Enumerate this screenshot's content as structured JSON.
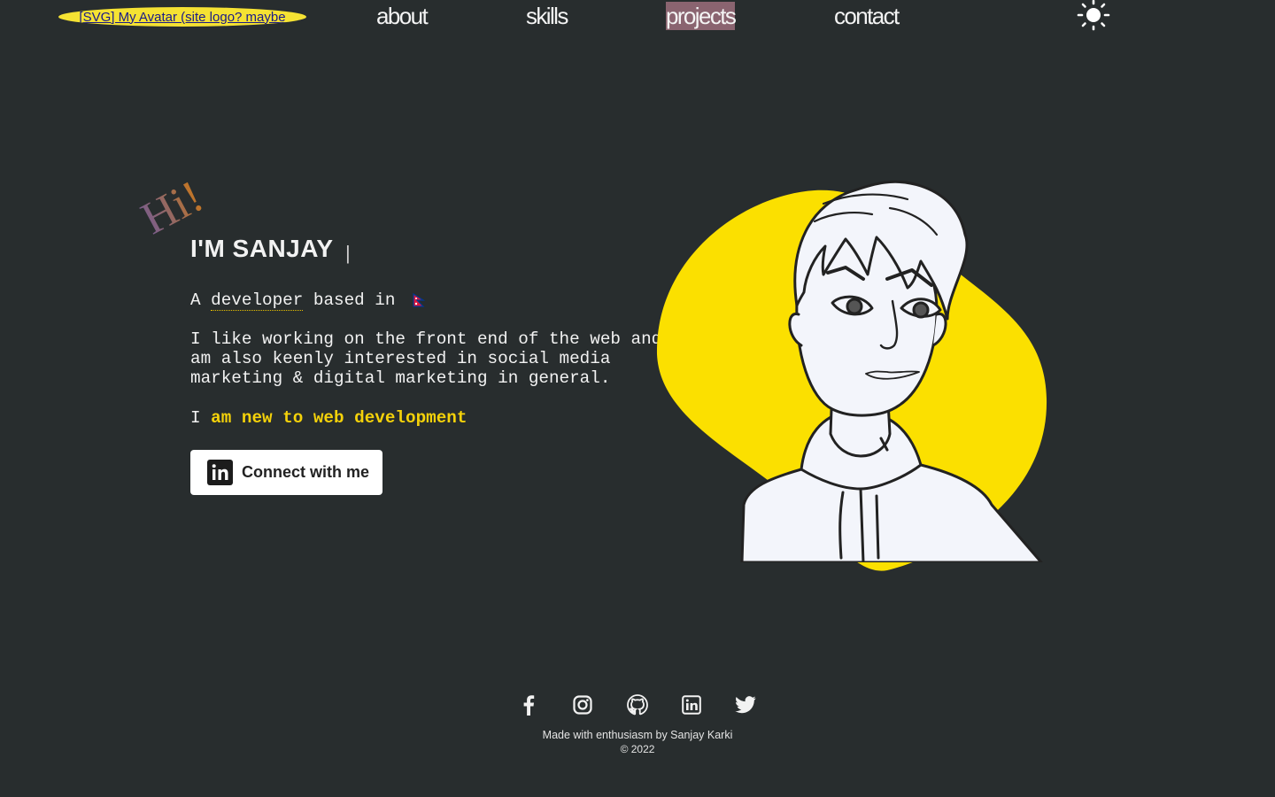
{
  "header": {
    "logo_alt": "[SVG] My Avatar (site logo? maybe",
    "nav": [
      {
        "label": "about"
      },
      {
        "label": "skills"
      },
      {
        "label": "projects",
        "active": true
      },
      {
        "label": "contact"
      }
    ],
    "theme_toggle_icon": "sun-icon"
  },
  "hero": {
    "greeting": "Hi!",
    "headline": "I'M SANJAY",
    "cursor": "|",
    "line1_prefix": "A",
    "line1_role": "developer",
    "line1_suffix": "based in",
    "flag_icon": "nepal-flag-icon",
    "bio": "I like working on the front end of the web and am also keenly interested in social media marketing & digital marketing in general.",
    "line3_prefix": "I",
    "line3_highlight": "am new to web development",
    "cta_label": "Connect with me",
    "cta_icon": "linkedin-icon",
    "avatar": "avatar-illustration"
  },
  "footer": {
    "social": [
      {
        "icon": "facebook-icon"
      },
      {
        "icon": "instagram-icon"
      },
      {
        "icon": "github-icon"
      },
      {
        "icon": "linkedin-icon"
      },
      {
        "icon": "twitter-icon"
      }
    ],
    "credit": "Made with enthusiasm by Sanjay Karki",
    "copyright": "© 2022"
  },
  "colors": {
    "background": "#282d2e",
    "accent": "#f5d20a",
    "nav_active": "#8a6470"
  }
}
